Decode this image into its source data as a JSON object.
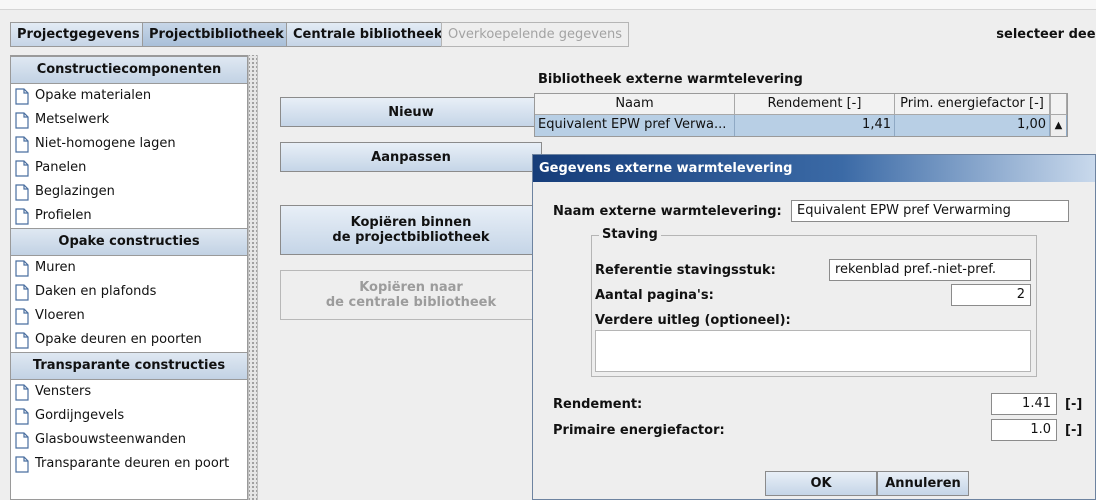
{
  "tabs": [
    {
      "label": "Projectgegevens",
      "state": "normal"
    },
    {
      "label": "Projectbibliotheek",
      "state": "active"
    },
    {
      "label": "Centrale bibliotheek",
      "state": "normal"
    },
    {
      "label": "Overkoepelende gegevens",
      "state": "disabled"
    }
  ],
  "top_right_label": "selecteer deel",
  "sidebar": {
    "sections": [
      {
        "title": "Constructiecomponenten",
        "items": [
          "Opake materialen",
          "Metselwerk",
          "Niet-homogene lagen",
          "Panelen",
          "Beglazingen",
          "Profielen"
        ]
      },
      {
        "title": "Opake constructies",
        "items": [
          "Muren",
          "Daken en plafonds",
          "Vloeren",
          "Opake deuren en poorten"
        ]
      },
      {
        "title": "Transparante constructies",
        "items": [
          "Vensters",
          "Gordijngevels",
          "Glasbouwsteenwanden",
          "Transparante deuren en poort"
        ]
      }
    ],
    "item_icon": "document-icon"
  },
  "actions": {
    "new": "Nieuw",
    "edit": "Aanpassen",
    "copy_within_1": "Kopiëren binnen",
    "copy_within_2": "de projectbibliotheek",
    "copy_to_central_1": "Kopiëren naar",
    "copy_to_central_2": "de centrale bibliotheek"
  },
  "library": {
    "title": "Bibliotheek externe warmtelevering",
    "columns": [
      "Naam",
      "Rendement [-]",
      "Prim. energiefactor [-]"
    ],
    "rows": [
      {
        "name": "Equivalent EPW pref Verwa...",
        "rendement": "1,41",
        "factor": "1,00"
      }
    ]
  },
  "dialog": {
    "title": "Gegevens externe warmtelevering",
    "name_label": "Naam externe warmtelevering:",
    "name_value": "Equivalent EPW pref Verwarming",
    "staving": {
      "title": "Staving",
      "ref_label": "Referentie stavingsstuk:",
      "ref_value": "rekenblad pref.-niet-pref.",
      "pages_label": "Aantal pagina's:",
      "pages_value": "2",
      "extra_label": "Verdere uitleg (optioneel):",
      "extra_value": ""
    },
    "rendement_label": "Rendement:",
    "rendement_value": "1.41",
    "rendement_unit": "[-]",
    "factor_label": "Primaire energiefactor:",
    "factor_value": "1.0",
    "factor_unit": "[-]",
    "ok_label": "OK",
    "cancel_label": "Annuleren"
  },
  "colors": {
    "tab_active": "#a9c0d9",
    "selected_row": "#b8cfe5",
    "dialog_title_start": "#163d7a",
    "dialog_title_end": "#c9d9ec"
  }
}
